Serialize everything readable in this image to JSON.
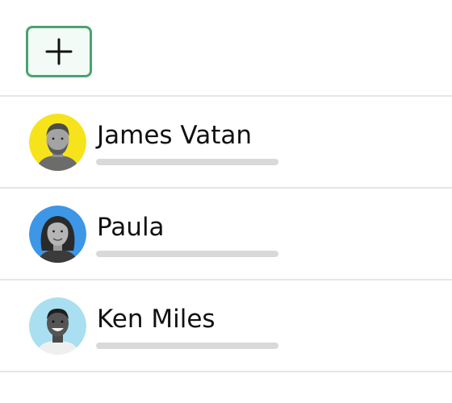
{
  "toolbar": {
    "add_button_icon": "plus-icon",
    "accent": "#4aa36f"
  },
  "contacts": [
    {
      "name": "James Vatan",
      "avatar_bg": "#f6e31b",
      "avatar_icon": "person-avatar"
    },
    {
      "name": "Paula",
      "avatar_bg": "#3d96e6",
      "avatar_icon": "person-avatar"
    },
    {
      "name": "Ken Miles",
      "avatar_bg": "#a9dff0",
      "avatar_icon": "person-avatar"
    }
  ]
}
